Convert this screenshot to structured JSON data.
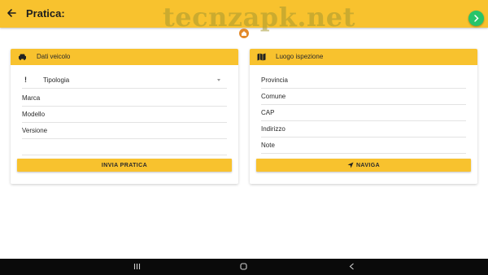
{
  "app": {
    "title": "Pratica:",
    "watermark": "tecnzapk.net",
    "accent_color": "#f8c22e",
    "fab_color": "#27c46a"
  },
  "vehicle_card": {
    "title": "Dati veicolo",
    "icon": "car-icon",
    "fields": [
      {
        "label": "Tipologia",
        "value": "",
        "type": "select",
        "status_icon": "!"
      },
      {
        "label": "Marca",
        "value": ""
      },
      {
        "label": "Modello",
        "value": ""
      },
      {
        "label": "Versione",
        "value": ""
      }
    ],
    "submit_label": "INVIA PRATICA"
  },
  "location_card": {
    "title": "Luogo ispezione",
    "icon": "map-icon",
    "fields": [
      {
        "label": "Provincia",
        "value": ""
      },
      {
        "label": "Comune",
        "value": ""
      },
      {
        "label": "CAP",
        "value": ""
      },
      {
        "label": "Indirizzo",
        "value": ""
      },
      {
        "label": "Note",
        "value": ""
      }
    ],
    "navigate_label": "NAVIGA"
  },
  "system_nav": {
    "icons": [
      "recent-apps-icon",
      "home-icon",
      "back-icon"
    ]
  }
}
